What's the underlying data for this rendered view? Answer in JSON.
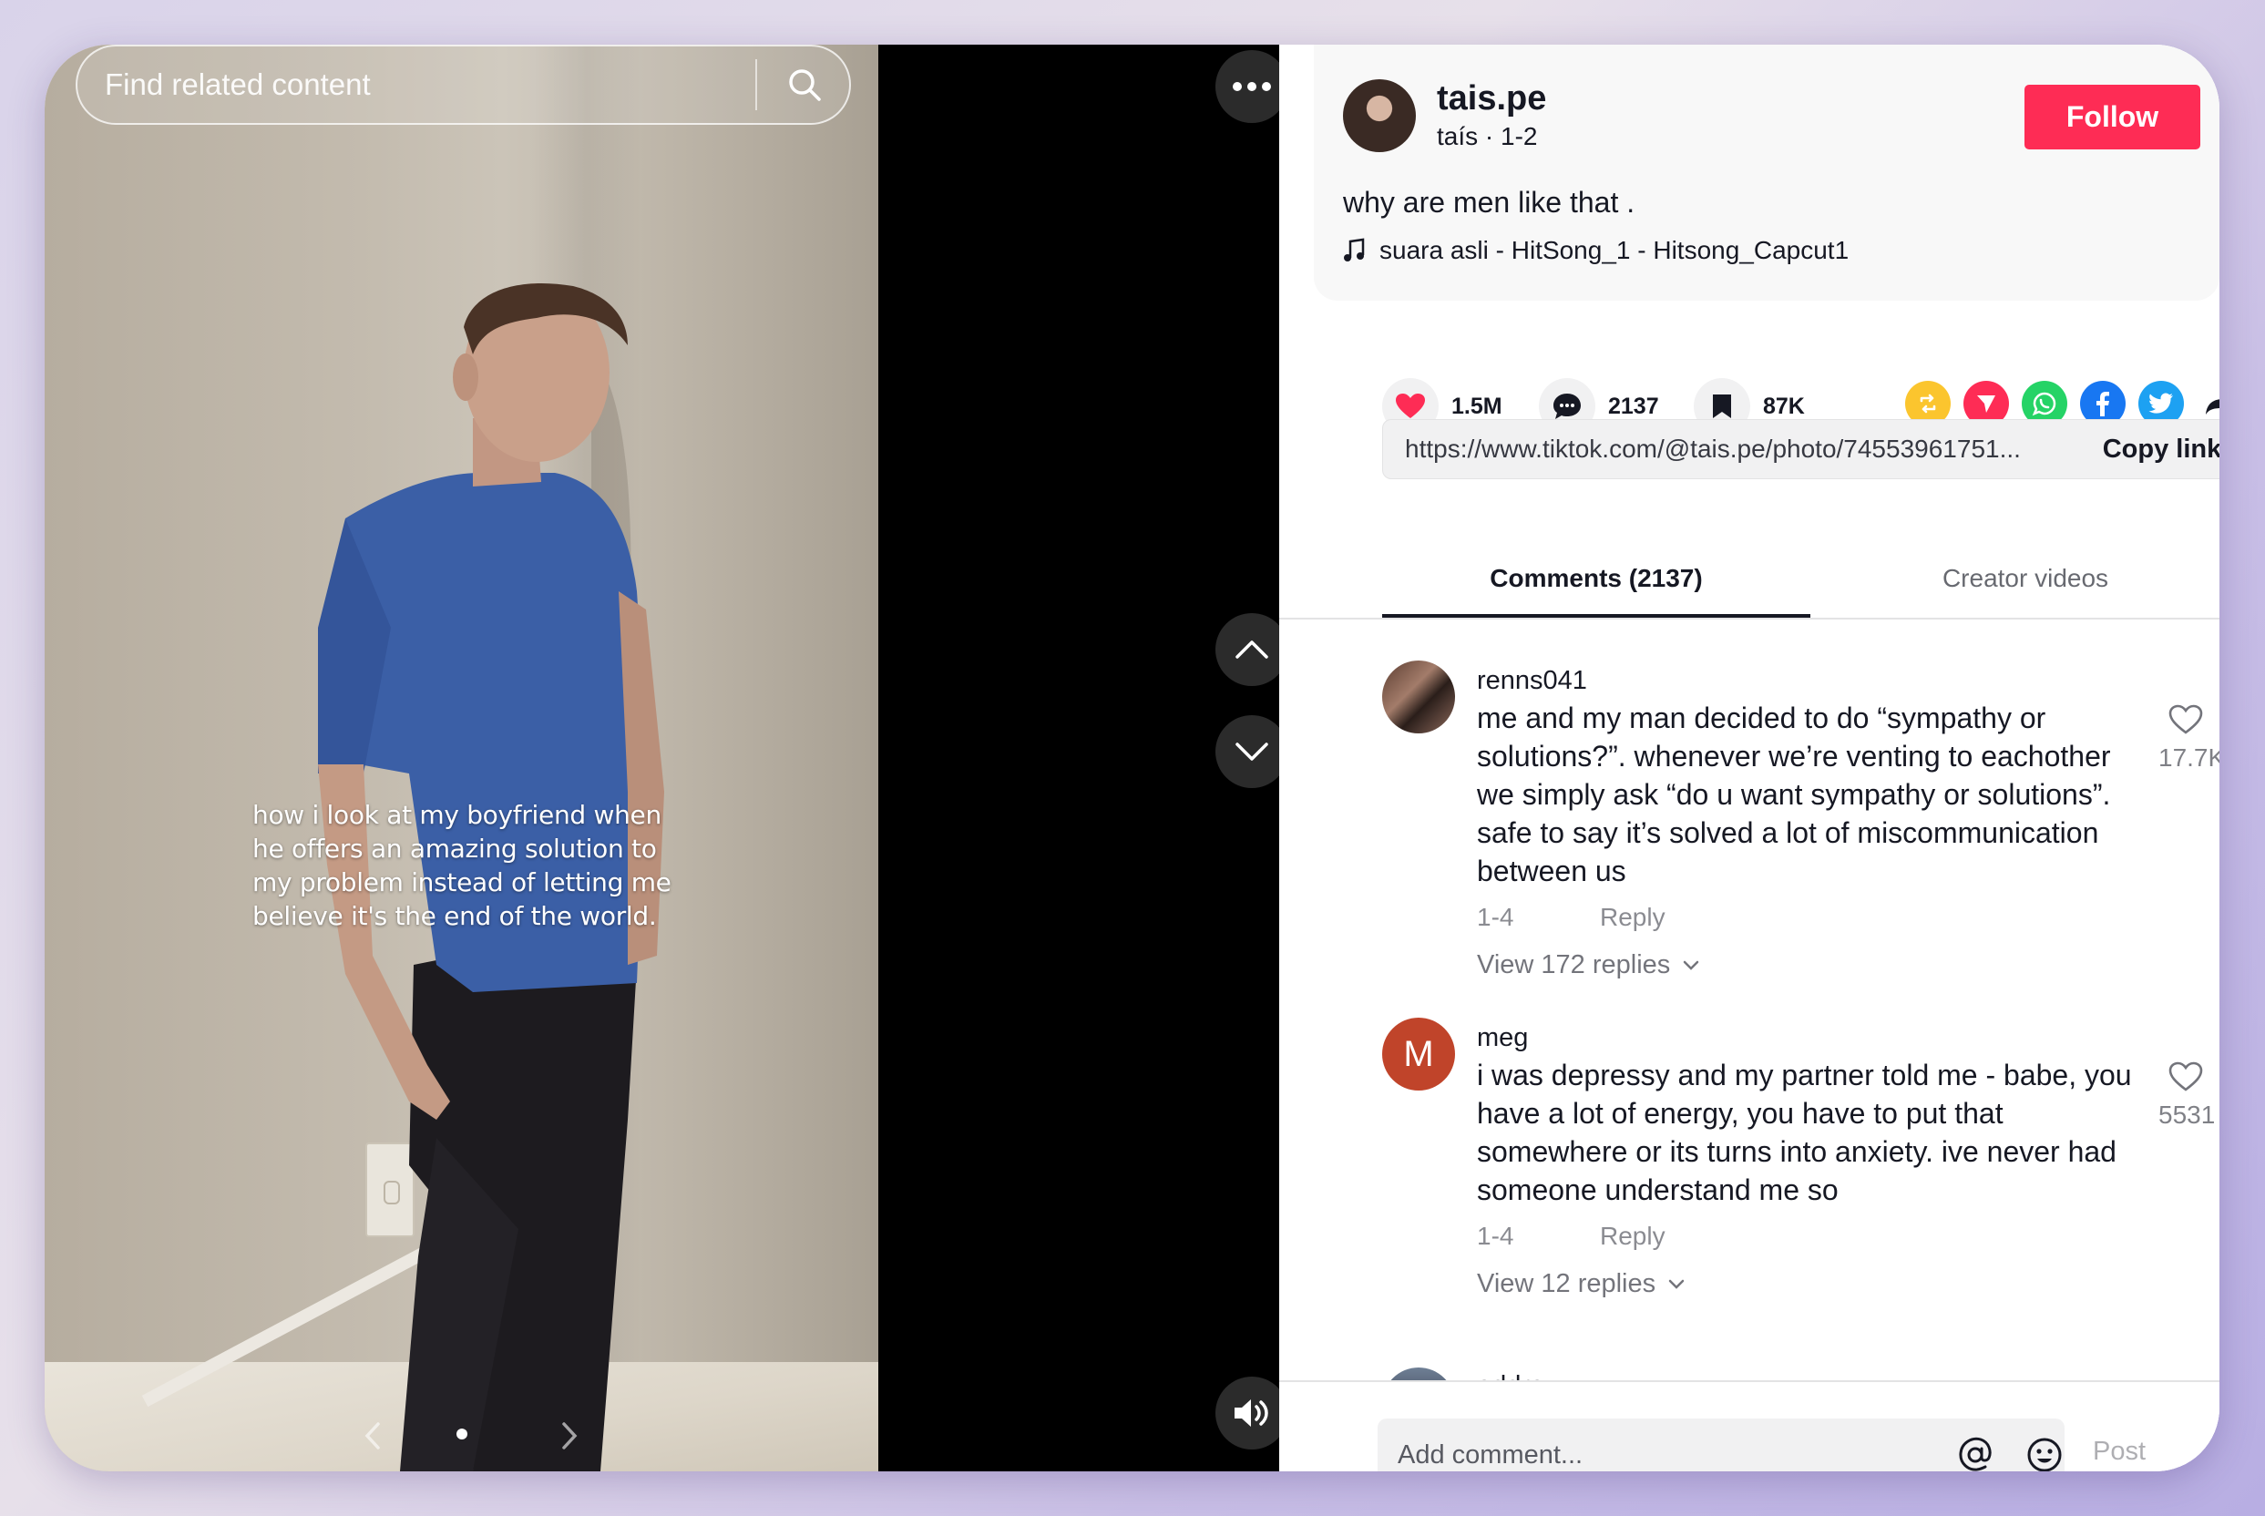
{
  "search": {
    "placeholder": "Find related content"
  },
  "photo": {
    "caption": "how i look at my boyfriend when he offers an amazing solution to my problem instead of letting me believe it's the end of the world."
  },
  "author": {
    "username": "tais.pe",
    "subline": "taís · 1-2",
    "follow_label": "Follow"
  },
  "post": {
    "description": "why are men like that .",
    "music": "suara asli - HitSong_1 - Hitsong_Capcut1"
  },
  "actions": {
    "likes": "1.5M",
    "comments": "2137",
    "saves": "87K",
    "share_icons": [
      "repost-icon",
      "send-icon",
      "whatsapp-icon",
      "facebook-icon",
      "twitter-icon",
      "share-arrow-icon"
    ]
  },
  "link": {
    "url": "https://www.tiktok.com/@tais.pe/photo/74553961751...",
    "copy_label": "Copy link"
  },
  "tabs": {
    "comments": "Comments (2137)",
    "creator": "Creator videos"
  },
  "comments": [
    {
      "user": "renns041",
      "text": "me and my man decided to do “sympathy or solutions?”. whenever we’re venting to eachother we simply ask “do u want sympathy or solutions”. safe to say it’s solved a lot of miscommunication between us",
      "date": "1-4",
      "reply_label": "Reply",
      "replies_label": "View 172 replies",
      "likes": "17.7K"
    },
    {
      "user": "meg",
      "avatar_letter": "M",
      "text": "i was depressy and my partner told me - babe, you have a lot of energy, you have to put that somewhere or its turns into anxiety. ive never had someone understand me so",
      "date": "1-4",
      "reply_label": "Reply",
      "replies_label": "View 12 replies",
      "likes": "5531"
    },
    {
      "user": "oddrey"
    }
  ],
  "comment_bar": {
    "placeholder": "Add comment...",
    "post_label": "Post"
  },
  "colors": {
    "accent": "#fe2c55",
    "text": "#161823",
    "meg_avatar": "#c0442a"
  }
}
